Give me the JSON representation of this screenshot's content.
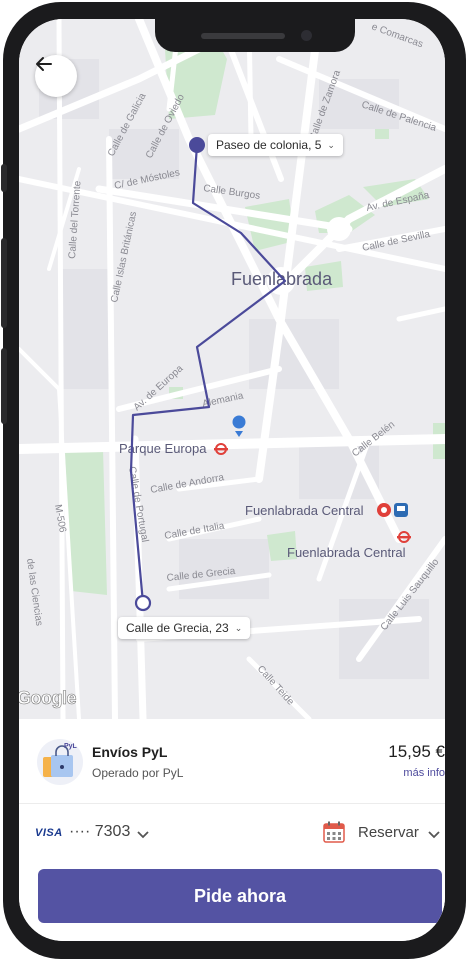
{
  "map": {
    "city_label": "Fuenlabrada",
    "street_labels": {
      "calle_de_galicia": "Calle de Galicia",
      "calle_de_oviedo": "Calle de Oviedo",
      "calle_de_zamora": "Calle de Zamora",
      "calle_de_palencia": "Calle de Palencia",
      "calle_comarcas": "e Comarcas",
      "c_de_mostoles": "C/ de Móstoles",
      "calle_burgos": "Calle Burgos",
      "av_de_espana": "Av. de España",
      "calle_del_torrente": "Calle del Torrente",
      "calle_islas_britanicas": "Calle Islas Británicas",
      "calle_de_sevilla": "Calle de Sevilla",
      "av_de_europa": "Av. de Europa",
      "alemania": "Alemania",
      "calle_belen": "Calle Belén",
      "calle_de_andorra": "Calle de Andorra",
      "calle_de_italia": "Calle de Italia",
      "calle_de_portugal": "Calle de Portugal",
      "calle_de_grecia": "Calle de Grecia",
      "calle_luis_sauquillo": "Calle Luis Sauquillo",
      "calle_teide": "Calle Teide",
      "m506": "M-506",
      "de_las_ciencias": "de las Ciencias"
    },
    "poi_labels": {
      "parque_europa": "Parque Europa",
      "fuenlabrada_central_1": "Fuenlabrada Central",
      "fuenlabrada_central_2": "Fuenlabrada Central"
    },
    "pickup_label": "Paseo de colonia, 5",
    "dropoff_label": "Calle de Grecia, 23",
    "attribution": "Google",
    "route_color": "#4b4a9a",
    "location_color": "#3a7bd5"
  },
  "service": {
    "avatar_text": "PyL",
    "name": "Envíos PyL",
    "operator": "Operado por PyL",
    "price": "15,95 €",
    "more_info": "más info"
  },
  "payment": {
    "card_brand": "VISA",
    "card_number": "···· 7303",
    "schedule_label": "Reservar"
  },
  "cta": {
    "label": "Pide ahora",
    "color": "#5453a3"
  },
  "icons": {
    "back": "arrow-left-icon",
    "chevron": "chevron-down-icon",
    "calendar": "calendar-icon",
    "metro": "metro-icon",
    "train": "train-icon",
    "location": "location-pin-icon"
  }
}
